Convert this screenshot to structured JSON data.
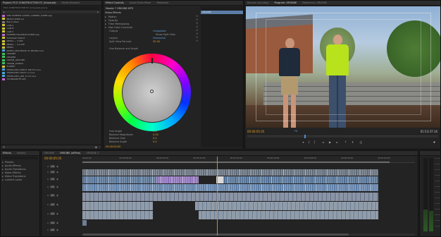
{
  "colors": {
    "accent_blue": "#3f5f86",
    "timecode_orange": "#e6a01e",
    "timecode_blue": "#5fa4e0",
    "video_clip": "#5b7da6",
    "audio_clip": "#6d7f95",
    "purple_clip": "#8a6db8"
  },
  "project": {
    "tabs": [
      "Project: PCO CONSTRUCTION FC (Unsaved)",
      "Media Browser"
    ],
    "folder": "PCO CONSTRUCTION FC (Unsaved).prproj",
    "items": [
      {
        "name": "WBC BUMPER LOWER_CORNER_SUPER.aep",
        "color": "#c06bd0"
      },
      {
        "name": "BEACH WIDE.avi",
        "color": "#d0c53a"
      },
      {
        "name": "Black Video",
        "color": "#7a7a7a"
      },
      {
        "name": "CAM A",
        "color": "#d0c53a"
      },
      {
        "name": "CAM B",
        "color": "#d0c53a"
      },
      {
        "name": "CAM C",
        "color": "#d0c53a"
      },
      {
        "name": "DARREN WALKMAN SUPER.aep",
        "color": "#c06bd0"
      },
      {
        "name": "FOOTAGE SHOOT",
        "color": "#d0c53a"
      },
      {
        "name": "MEDIA — T-VAR",
        "color": "#d0c53a"
      },
      {
        "name": "MEDIA — V1.AVE",
        "color": "#d0c53a"
      },
      {
        "name": "MEDIA",
        "color": "#d0c53a"
      },
      {
        "name": "RETRO_SEQUENCE V1 PROMO.mov",
        "color": "#4aa3d8"
      },
      {
        "name": "ORIGINE",
        "color": "#3ec05a"
      },
      {
        "name": "ORIGINE",
        "color": "#3ec05a"
      },
      {
        "name": "ORIGIN_GROUND",
        "color": "#3ec05a"
      },
      {
        "name": "ORIGIN_WORKS",
        "color": "#3ec05a"
      },
      {
        "name": "SURFBC",
        "color": "#d0c53a"
      },
      {
        "name": "TEMPLATES WRECT 3M:F10.mov",
        "color": "#4aa3d8"
      },
      {
        "name": "TEMPLATES TRACT L1.mov",
        "color": "#4aa3d8"
      },
      {
        "name": "TEMPLATES_APR 13 22.mov",
        "color": "#4aa3d8"
      },
      {
        "name": "YOUNGWRITE.APS",
        "color": "#c06bd0"
      }
    ]
  },
  "effects_panel": {
    "tabs": [
      "Effect Controls",
      "Audio Track Mixer",
      "Metadata"
    ],
    "header": "Video Effects",
    "sequence_label": "ORIGINE",
    "clip_label": "Master * ORIGINE.MTS",
    "rows": [
      {
        "label": "Motion",
        "value": ""
      },
      {
        "label": "Opacity",
        "value": ""
      },
      {
        "label": "Time Remapping",
        "value": ""
      },
      {
        "label": "Fast Color Corrector",
        "value": ""
      },
      {
        "label": "Output",
        "value": "Composite"
      },
      {
        "label": "Show Split View",
        "value": ""
      },
      {
        "label": "Layout",
        "value": "Horizontal"
      },
      {
        "label": "Split View Percent",
        "value": "50.00"
      },
      {
        "label": "Hue Balance and Angle",
        "value": ""
      }
    ],
    "bottom_rows": [
      {
        "label": "Hue Angle",
        "value": "0.0"
      },
      {
        "label": "Balance Magnitude",
        "value": "0.00"
      },
      {
        "label": "Balance Gain",
        "value": "0.0"
      },
      {
        "label": "Balance Angle",
        "value": "0.0"
      }
    ],
    "timecode": "00:00:00:00"
  },
  "program": {
    "tabs": [
      "Source: (no clips)",
      "Program: ORIGINE",
      "Reference: ORIGINE"
    ],
    "timecode_left": "00:00:05:05",
    "timecode_right": "01:53:37:16",
    "fit": "Fit"
  },
  "effects_browser": {
    "tabs": [
      "Effects",
      "History"
    ],
    "items": [
      "Presets",
      "Audio Effects",
      "Audio Transitions",
      "Video Effects",
      "Video Transitions",
      "Lumetri Looks"
    ]
  },
  "timeline": {
    "tabs": [
      "ORIGINE",
      "ORIGINE (offline)",
      "ORIGINE 2"
    ],
    "timecode": "00:00:05:05",
    "ruler": [
      "00:00:00",
      "00:00:08:00",
      "00:00:16:00",
      "00:00:24:00",
      "00:00:32:00",
      "00:00:40:00",
      "00:00:48:00",
      "00:00:56:00",
      "00:01:04:00"
    ],
    "tracks": [
      "V4",
      "V3",
      "V2",
      "V1",
      "A1",
      "A2",
      "A3",
      "A4",
      "A5"
    ]
  }
}
